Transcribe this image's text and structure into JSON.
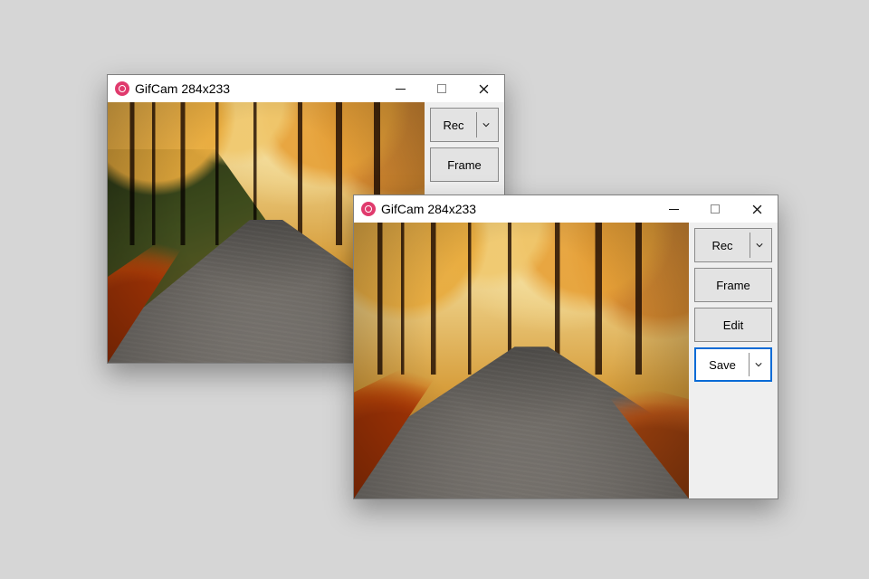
{
  "windows": [
    {
      "title": "GifCam 284x233",
      "buttons": {
        "rec": "Rec",
        "frame": "Frame"
      }
    },
    {
      "title": "GifCam 284x233",
      "buttons": {
        "rec": "Rec",
        "frame": "Frame",
        "edit": "Edit",
        "save": "Save"
      }
    }
  ]
}
